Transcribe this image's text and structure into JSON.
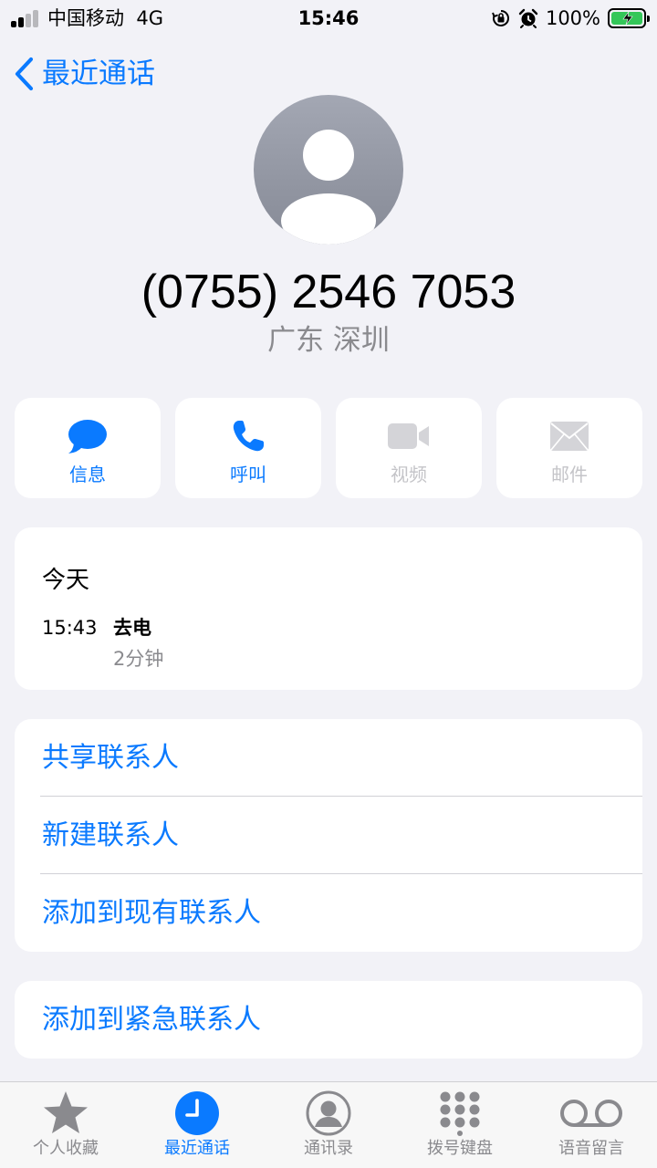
{
  "status_bar": {
    "carrier": "中国移动",
    "network": "4G",
    "time": "15:46",
    "battery": "100%"
  },
  "nav": {
    "back_label": "最近通话"
  },
  "contact": {
    "phone_number": "(0755) 2546 7053",
    "location": "广东 深圳"
  },
  "actions": [
    {
      "label": "信息",
      "icon": "message-bubble-icon",
      "enabled": true
    },
    {
      "label": "呼叫",
      "icon": "phone-icon",
      "enabled": true
    },
    {
      "label": "视频",
      "icon": "video-camera-icon",
      "enabled": false
    },
    {
      "label": "邮件",
      "icon": "mail-envelope-icon",
      "enabled": false
    }
  ],
  "history": {
    "date": "今天",
    "entries": [
      {
        "time": "15:43",
        "type": "去电",
        "duration": "2分钟"
      }
    ]
  },
  "menu": {
    "share_contact": "共享联系人",
    "new_contact": "新建联系人",
    "add_to_existing": "添加到现有联系人",
    "add_to_emergency": "添加到紧急联系人"
  },
  "tabs": [
    {
      "label": "个人收藏",
      "icon": "star-icon",
      "selected": false
    },
    {
      "label": "最近通话",
      "icon": "clock-icon",
      "selected": true
    },
    {
      "label": "通讯录",
      "icon": "person-circle-icon",
      "selected": false
    },
    {
      "label": "拨号键盘",
      "icon": "keypad-icon",
      "selected": false
    },
    {
      "label": "语音留言",
      "icon": "voicemail-icon",
      "selected": false
    }
  ],
  "colors": {
    "accent": "#0a7aff",
    "background": "#f2f2f7",
    "secondary_text": "#8a8a8e",
    "disabled": "#d4d4d8",
    "battery_fill": "#34c759"
  }
}
